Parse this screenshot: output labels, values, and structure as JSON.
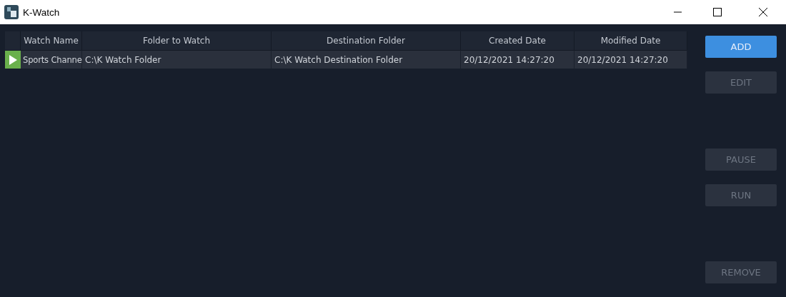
{
  "window": {
    "title": "K-Watch"
  },
  "table": {
    "columns": [
      "Watch Name",
      "Folder to Watch",
      "Destination Folder",
      "Created Date",
      "Modified Date"
    ],
    "rows": [
      {
        "running": true,
        "cells": [
          "Sports Channe",
          "C:\\K Watch Folder",
          "C:\\K Watch Destination Folder",
          "20/12/2021 14:27:20",
          "20/12/2021 14:27:20"
        ]
      }
    ]
  },
  "buttons": [
    {
      "label": "ADD",
      "disabled": false
    },
    {
      "label": "EDIT",
      "disabled": true
    },
    {
      "label": "PAUSE",
      "disabled": true
    },
    {
      "label": "RUN",
      "disabled": true
    },
    {
      "label": "REMOVE",
      "disabled": true
    }
  ]
}
